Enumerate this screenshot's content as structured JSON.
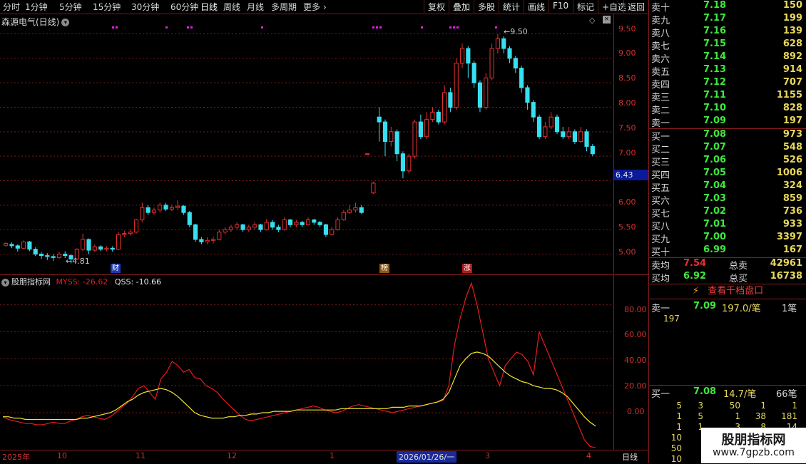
{
  "toolbar": {
    "periods": [
      "分时",
      "1分钟",
      "5分钟",
      "15分钟",
      "30分钟",
      "60分钟",
      "日线",
      "周线",
      "月线",
      "多周期",
      "更多"
    ],
    "active_period": "日线",
    "buttons": [
      "复权",
      "叠加",
      "多股",
      "统计",
      "画线",
      "F10",
      "标记",
      "+自选",
      "返回"
    ]
  },
  "chart": {
    "title": "森源电气(日线)",
    "price_ticks": [
      "9.50",
      "9.00",
      "8.50",
      "8.00",
      "7.50",
      "7.00",
      "6.43",
      "6.00",
      "5.50",
      "5.00"
    ],
    "current_price": "6.43",
    "high_label": "9.50",
    "low_label": "4.81",
    "markers": [
      "财",
      "榜",
      "涨"
    ]
  },
  "indicator": {
    "name": "股朋指标网",
    "myss_label": "MYSS: -26.62",
    "qss_label": "QSS: -10.66",
    "ticks": [
      "80.00",
      "60.00",
      "40.00",
      "20.00",
      "0.00"
    ]
  },
  "dates": {
    "labels": [
      "2025年",
      "10",
      "11",
      "12",
      "1",
      "2026/01/26/一",
      "3",
      "4"
    ],
    "period_tag": "日线"
  },
  "orderbook": {
    "asks": [
      {
        "label": "卖十",
        "price": "7.18",
        "vol": "150"
      },
      {
        "label": "卖九",
        "price": "7.17",
        "vol": "199"
      },
      {
        "label": "卖八",
        "price": "7.16",
        "vol": "139"
      },
      {
        "label": "卖七",
        "price": "7.15",
        "vol": "628"
      },
      {
        "label": "卖六",
        "price": "7.14",
        "vol": "892"
      },
      {
        "label": "卖五",
        "price": "7.13",
        "vol": "914"
      },
      {
        "label": "卖四",
        "price": "7.12",
        "vol": "707"
      },
      {
        "label": "卖三",
        "price": "7.11",
        "vol": "1155"
      },
      {
        "label": "卖二",
        "price": "7.10",
        "vol": "828"
      },
      {
        "label": "卖一",
        "price": "7.09",
        "vol": "197"
      }
    ],
    "bids": [
      {
        "label": "买一",
        "price": "7.08",
        "vol": "973"
      },
      {
        "label": "买二",
        "price": "7.07",
        "vol": "548"
      },
      {
        "label": "买三",
        "price": "7.06",
        "vol": "526"
      },
      {
        "label": "买四",
        "price": "7.05",
        "vol": "1006"
      },
      {
        "label": "买五",
        "price": "7.04",
        "vol": "324"
      },
      {
        "label": "买六",
        "price": "7.03",
        "vol": "859"
      },
      {
        "label": "买七",
        "price": "7.02",
        "vol": "736"
      },
      {
        "label": "买八",
        "price": "7.01",
        "vol": "933"
      },
      {
        "label": "买九",
        "price": "7.00",
        "vol": "3397"
      },
      {
        "label": "买十",
        "price": "6.99",
        "vol": "167"
      }
    ],
    "avg_sell_label": "卖均",
    "avg_sell_price": "7.54",
    "total_sell_label": "总卖",
    "total_sell": "42961",
    "avg_buy_label": "买均",
    "avg_buy_price": "6.92",
    "total_buy_label": "总买",
    "total_buy": "16738",
    "depth_button": "查看千档盘口",
    "sell1_label": "卖一",
    "sell1_price": "7.09",
    "sell1_detail": "197.0/笔",
    "sell1_count": "1笔",
    "sell1_queue": "197",
    "buy1_label": "买一",
    "buy1_price": "7.08",
    "buy1_detail": "14.7/笔",
    "buy1_count": "66笔",
    "buy1_queue": [
      [
        "5",
        "3",
        "50",
        "1",
        "1"
      ],
      [
        "1",
        "5",
        "1",
        "38",
        "181"
      ],
      [
        "1",
        "1",
        "3",
        "8",
        "14"
      ],
      [
        "10"
      ],
      [
        "50"
      ],
      [
        "10"
      ]
    ]
  },
  "watermark": {
    "name": "股朋指标网",
    "url": "www.7gpzb.com"
  },
  "colors": {
    "up": "#e83030",
    "down": "#36e0f0",
    "grid": "#7a1a1a",
    "myss": "#e81c1c",
    "qss": "#f0e830"
  },
  "chart_data": {
    "type": "candlestick",
    "ylim": [
      4.6,
      9.9
    ],
    "candles": [
      [
        5.18,
        5.22,
        5.25,
        5.15
      ],
      [
        5.2,
        5.17,
        5.24,
        5.12
      ],
      [
        5.17,
        5.12,
        5.2,
        5.05
      ],
      [
        5.12,
        5.25,
        5.28,
        5.1
      ],
      [
        5.25,
        5.1,
        5.27,
        5.06
      ],
      [
        5.1,
        5.0,
        5.14,
        4.96
      ],
      [
        5.0,
        4.97,
        5.04,
        4.9
      ],
      [
        4.97,
        4.95,
        5.02,
        4.88
      ],
      [
        4.95,
        4.93,
        5.0,
        4.86
      ],
      [
        4.93,
        5.0,
        5.05,
        4.9
      ],
      [
        5.0,
        4.97,
        5.06,
        4.92
      ],
      [
        4.97,
        4.9,
        5.0,
        4.81
      ],
      [
        4.9,
        5.1,
        5.12,
        4.88
      ],
      [
        5.1,
        5.3,
        5.42,
        5.05
      ],
      [
        5.3,
        5.08,
        5.32,
        5.0
      ],
      [
        5.08,
        5.15,
        5.2,
        5.04
      ],
      [
        5.15,
        5.1,
        5.18,
        5.06
      ],
      [
        5.1,
        5.12,
        5.16,
        5.06
      ],
      [
        5.12,
        5.1,
        5.16,
        5.05
      ],
      [
        5.1,
        5.4,
        5.45,
        5.08
      ],
      [
        5.4,
        5.42,
        5.48,
        5.35
      ],
      [
        5.42,
        5.45,
        5.5,
        5.38
      ],
      [
        5.45,
        5.7,
        5.72,
        5.42
      ],
      [
        5.7,
        5.95,
        6.05,
        5.65
      ],
      [
        5.95,
        5.85,
        6.0,
        5.8
      ],
      [
        5.85,
        5.9,
        5.95,
        5.8
      ],
      [
        5.9,
        6.0,
        6.05,
        5.85
      ],
      [
        6.0,
        5.92,
        6.05,
        5.88
      ],
      [
        5.92,
        5.95,
        6.0,
        5.88
      ],
      [
        5.95,
        5.98,
        6.1,
        5.9
      ],
      [
        5.98,
        5.85,
        6.0,
        5.8
      ],
      [
        5.85,
        5.6,
        5.88,
        5.55
      ],
      [
        5.6,
        5.3,
        5.62,
        5.25
      ],
      [
        5.3,
        5.25,
        5.35,
        5.2
      ],
      [
        5.25,
        5.28,
        5.35,
        5.2
      ],
      [
        5.28,
        5.3,
        5.35,
        5.22
      ],
      [
        5.3,
        5.45,
        5.5,
        5.28
      ],
      [
        5.45,
        5.5,
        5.55,
        5.4
      ],
      [
        5.5,
        5.55,
        5.6,
        5.45
      ],
      [
        5.55,
        5.6,
        5.65,
        5.5
      ],
      [
        5.6,
        5.5,
        5.62,
        5.45
      ],
      [
        5.5,
        5.55,
        5.6,
        5.45
      ],
      [
        5.55,
        5.6,
        5.65,
        5.5
      ],
      [
        5.6,
        5.5,
        5.62,
        5.45
      ],
      [
        5.5,
        5.65,
        5.72,
        5.48
      ],
      [
        5.65,
        5.55,
        5.7,
        5.5
      ],
      [
        5.55,
        5.5,
        5.6,
        5.45
      ],
      [
        5.5,
        5.7,
        5.75,
        5.48
      ],
      [
        5.7,
        5.6,
        5.72,
        5.55
      ],
      [
        5.6,
        5.65,
        5.7,
        5.55
      ],
      [
        5.65,
        5.6,
        5.68,
        5.55
      ],
      [
        5.6,
        5.7,
        5.75,
        5.58
      ],
      [
        5.7,
        5.65,
        5.72,
        5.6
      ],
      [
        5.65,
        5.6,
        5.68,
        5.55
      ],
      [
        5.6,
        5.4,
        5.62,
        5.35
      ],
      [
        5.4,
        5.5,
        5.55,
        5.38
      ],
      [
        5.5,
        5.7,
        5.75,
        5.48
      ],
      [
        5.7,
        5.85,
        5.9,
        5.68
      ],
      [
        5.85,
        5.9,
        6.0,
        5.82
      ],
      [
        5.9,
        5.95,
        6.05,
        5.85
      ],
      [
        5.95,
        5.85,
        6.0,
        5.82
      ],
      [
        7.05,
        7.05,
        7.05,
        7.05
      ],
      [
        6.25,
        6.45,
        6.48,
        6.23
      ],
      [
        7.8,
        7.7,
        8.0,
        7.3
      ],
      [
        7.7,
        7.3,
        7.75,
        7.0
      ],
      [
        7.3,
        7.5,
        7.6,
        7.2
      ],
      [
        7.5,
        7.05,
        7.55,
        6.9
      ],
      [
        7.05,
        6.7,
        7.1,
        6.55
      ],
      [
        6.7,
        7.0,
        7.05,
        6.65
      ],
      [
        7.0,
        7.7,
        7.75,
        6.95
      ],
      [
        7.7,
        7.4,
        7.85,
        7.35
      ],
      [
        7.4,
        7.75,
        7.9,
        7.35
      ],
      [
        7.75,
        7.9,
        8.0,
        7.7
      ],
      [
        7.9,
        7.7,
        7.95,
        7.65
      ],
      [
        7.7,
        8.3,
        8.45,
        7.65
      ],
      [
        8.3,
        8.0,
        8.4,
        7.9
      ],
      [
        8.0,
        8.9,
        9.0,
        7.95
      ],
      [
        8.9,
        9.2,
        9.3,
        8.8
      ],
      [
        9.2,
        8.9,
        9.25,
        8.6
      ],
      [
        8.9,
        8.5,
        8.95,
        8.4
      ],
      [
        8.5,
        8.0,
        8.55,
        7.9
      ],
      [
        8.0,
        8.6,
        8.7,
        7.95
      ],
      [
        8.6,
        9.2,
        9.3,
        8.55
      ],
      [
        9.2,
        9.4,
        9.5,
        9.1
      ],
      [
        9.4,
        9.2,
        9.45,
        9.1
      ],
      [
        9.2,
        9.0,
        9.25,
        8.9
      ],
      [
        9.0,
        8.8,
        9.05,
        8.7
      ],
      [
        8.8,
        8.4,
        8.85,
        8.3
      ],
      [
        8.4,
        8.1,
        8.45,
        7.95
      ],
      [
        8.1,
        7.8,
        8.15,
        7.7
      ],
      [
        7.8,
        7.4,
        7.85,
        7.35
      ],
      [
        7.4,
        7.6,
        7.7,
        7.35
      ],
      [
        7.6,
        7.8,
        7.9,
        7.55
      ],
      [
        7.8,
        7.5,
        7.85,
        7.45
      ],
      [
        7.5,
        7.4,
        7.6,
        7.35
      ],
      [
        7.4,
        7.5,
        7.6,
        7.35
      ],
      [
        7.5,
        7.3,
        7.55,
        7.25
      ],
      [
        7.3,
        7.5,
        7.6,
        7.28
      ],
      [
        7.5,
        7.2,
        7.55,
        7.1
      ],
      [
        7.2,
        7.05,
        7.25,
        7.0
      ]
    ],
    "myss": [
      -3,
      -5,
      -6,
      -7,
      -8,
      -8,
      -9,
      -9,
      -8,
      -7,
      -8,
      -8,
      -6,
      -5,
      -3,
      -2,
      -3,
      -4,
      -5,
      -3,
      0,
      4,
      7,
      12,
      18,
      20,
      15,
      10,
      25,
      30,
      38,
      35,
      30,
      32,
      26,
      25,
      20,
      18,
      15,
      10,
      6,
      2,
      -2,
      -5,
      -6,
      -5,
      -4,
      -3,
      -2,
      -1,
      0,
      1,
      2,
      3,
      4,
      5,
      4,
      2,
      1,
      0,
      1,
      3,
      5,
      6,
      5,
      4,
      3,
      2,
      1,
      0,
      1,
      2,
      3,
      4,
      5,
      6,
      7,
      8,
      9,
      20,
      50,
      70,
      85,
      96,
      80,
      60,
      40,
      30,
      20,
      35,
      40,
      45,
      43,
      38,
      28,
      60,
      50,
      40,
      30,
      20,
      10,
      0,
      -10,
      -20,
      -25,
      -26
    ],
    "qss": [
      -3,
      -3,
      -4,
      -4,
      -5,
      -5,
      -5,
      -5,
      -5,
      -5,
      -5,
      -5,
      -5,
      -5,
      -4,
      -4,
      -3,
      -2,
      -1,
      0,
      2,
      5,
      8,
      10,
      13,
      15,
      16,
      17,
      18,
      17,
      15,
      12,
      8,
      4,
      0,
      -2,
      -3,
      -4,
      -4,
      -4,
      -3,
      -3,
      -2,
      -2,
      -1,
      -1,
      0,
      0,
      1,
      1,
      1,
      1,
      2,
      2,
      2,
      2,
      2,
      2,
      2,
      2,
      3,
      3,
      3,
      3,
      3,
      3,
      3,
      3,
      3,
      4,
      4,
      4,
      5,
      5,
      5,
      6,
      7,
      8,
      10,
      15,
      25,
      35,
      40,
      44,
      45,
      44,
      42,
      38,
      34,
      30,
      27,
      25,
      23,
      22,
      20,
      19,
      18,
      18,
      17,
      15,
      12,
      7,
      2,
      -3,
      -7,
      -10
    ]
  }
}
